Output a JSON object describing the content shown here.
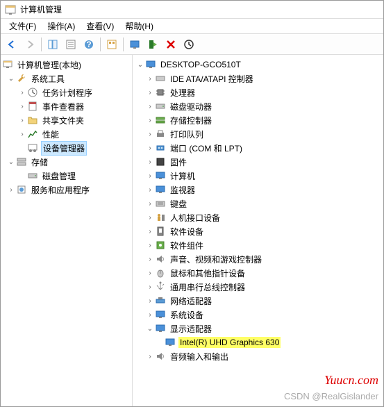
{
  "title": "计算机管理",
  "menu": {
    "file": "文件(F)",
    "action": "操作(A)",
    "view": "查看(V)",
    "help": "帮助(H)"
  },
  "left_tree": {
    "root": "计算机管理(本地)",
    "system_tools": "系统工具",
    "task_scheduler": "任务计划程序",
    "event_viewer": "事件查看器",
    "shared_folders": "共享文件夹",
    "performance": "性能",
    "device_manager": "设备管理器",
    "storage": "存储",
    "disk_management": "磁盘管理",
    "services_apps": "服务和应用程序"
  },
  "right_tree": {
    "computer": "DESKTOP-GCO510T",
    "ide": "IDE ATA/ATAPI 控制器",
    "processor": "处理器",
    "disk_drives": "磁盘驱动器",
    "storage_controllers": "存储控制器",
    "print_queue": "打印队列",
    "ports": "端口 (COM 和 LPT)",
    "firmware": "固件",
    "computers": "计算机",
    "monitors": "监视器",
    "keyboards": "键盘",
    "hid": "人机接口设备",
    "software_devices": "软件设备",
    "software_components": "软件组件",
    "sound": "声音、视频和游戏控制器",
    "mice": "鼠标和其他指针设备",
    "usb": "通用串行总线控制器",
    "network": "网络适配器",
    "system_devices": "系统设备",
    "display_adapters": "显示适配器",
    "gpu": "Intel(R) UHD Graphics 630",
    "audio_io": "音频输入和输出"
  },
  "watermark1": "Yuucn.com",
  "watermark2": "CSDN @RealGislander"
}
